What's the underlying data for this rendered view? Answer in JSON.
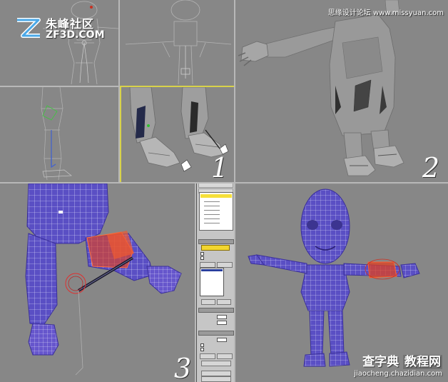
{
  "watermark_top": "思缘设计论坛 www.missyuan.com",
  "logo": {
    "cn": "朱峰社区",
    "en": "ZF3D.COM"
  },
  "watermark_bottom": {
    "main": "查字典",
    "highlight": "教程网",
    "url": "jiaocheng.chazidian.com"
  },
  "viewport_numbers": [
    "1",
    "2",
    "3"
  ],
  "colors": {
    "viewport_bg": "#878787",
    "active_border": "#d8d24a",
    "mesh_blue": "#5a4fc4",
    "mesh_wire": "#e8e8ff",
    "bone_red": "#e04020",
    "button_yellow": "#f2d630"
  },
  "icons": [
    "logo-z-icon",
    "3d-model-legs",
    "3d-model-full-body",
    "character-skinned-mesh",
    "character-envelope-mesh",
    "command-panel"
  ]
}
